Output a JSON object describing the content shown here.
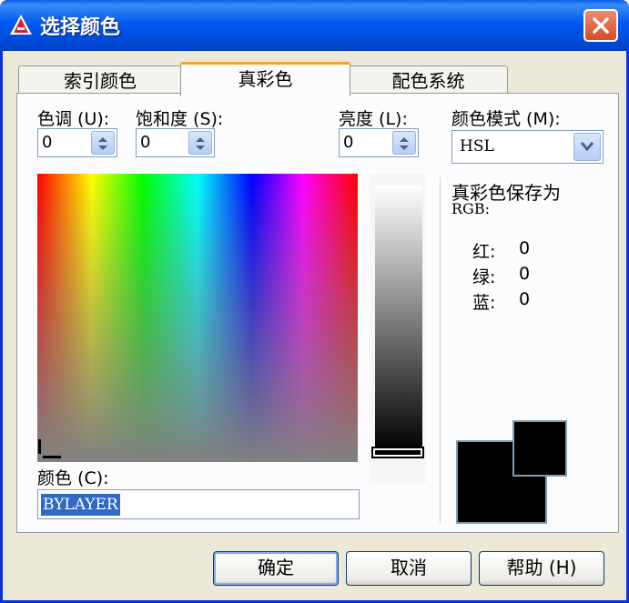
{
  "window": {
    "title": "选择颜色"
  },
  "tabs": [
    {
      "label": "索引颜色",
      "active": false
    },
    {
      "label": "真彩色",
      "active": true
    },
    {
      "label": "配色系统",
      "active": false
    }
  ],
  "hue": {
    "label": "色调 (U):",
    "value": "0"
  },
  "saturation": {
    "label": "饱和度 (S):",
    "value": "0"
  },
  "luminance": {
    "label": "亮度 (L):",
    "value": "0"
  },
  "color_model": {
    "label": "颜色模式 (M):",
    "value": "HSL"
  },
  "stored_as": {
    "title": "真彩色保存为",
    "subtitle": "RGB:"
  },
  "rgb": [
    {
      "label": "红:",
      "value": "0"
    },
    {
      "label": "绿:",
      "value": "0"
    },
    {
      "label": "蓝:",
      "value": "0"
    }
  ],
  "color_field": {
    "label": "颜色 (C):",
    "value": "BYLAYER"
  },
  "buttons": {
    "ok": "确定",
    "cancel": "取消",
    "help": "帮助 (H)"
  },
  "colors": {
    "titlebar": "#0058ee",
    "dialog_bg": "#ece9d8",
    "selection": "#316ac5",
    "tab_highlight": "#f5a621"
  }
}
